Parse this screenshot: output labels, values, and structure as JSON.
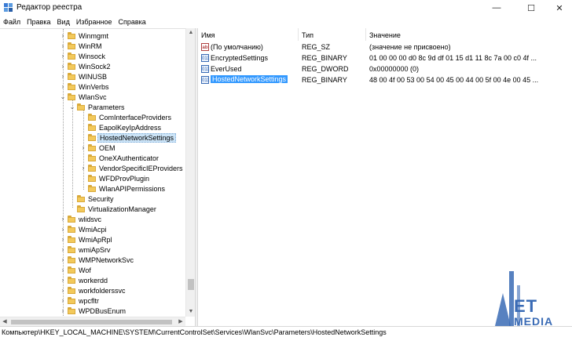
{
  "window": {
    "title": "Редактор реестра",
    "minimize": "—",
    "maximize": "☐",
    "close": "✕"
  },
  "menu": [
    "Файл",
    "Правка",
    "Вид",
    "Избранное",
    "Справка"
  ],
  "tree": [
    {
      "label": "Winmgmt",
      "level": 0,
      "expander": "collapsed"
    },
    {
      "label": "WinRM",
      "level": 0,
      "expander": "collapsed"
    },
    {
      "label": "Winsock",
      "level": 0,
      "expander": "collapsed"
    },
    {
      "label": "WinSock2",
      "level": 0,
      "expander": "collapsed"
    },
    {
      "label": "WINUSB",
      "level": 0,
      "expander": "collapsed"
    },
    {
      "label": "WinVerbs",
      "level": 0,
      "expander": "collapsed"
    },
    {
      "label": "WlanSvc",
      "level": 0,
      "expander": "expanded"
    },
    {
      "label": "Parameters",
      "level": 1,
      "expander": "expanded"
    },
    {
      "label": "ComInterfaceProviders",
      "level": 2,
      "expander": "none"
    },
    {
      "label": "EapolKeyIpAddress",
      "level": 2,
      "expander": "none"
    },
    {
      "label": "HostedNetworkSettings",
      "level": 2,
      "expander": "none",
      "selected": true
    },
    {
      "label": "OEM",
      "level": 2,
      "expander": "collapsed"
    },
    {
      "label": "OneXAuthenticator",
      "level": 2,
      "expander": "none"
    },
    {
      "label": "VendorSpecificIEProviders",
      "level": 2,
      "expander": "collapsed"
    },
    {
      "label": "WFDProvPlugin",
      "level": 2,
      "expander": "none"
    },
    {
      "label": "WlanAPIPermissions",
      "level": 2,
      "expander": "none"
    },
    {
      "label": "Security",
      "level": 1,
      "expander": "none"
    },
    {
      "label": "VirtualizationManager",
      "level": 1,
      "expander": "none"
    },
    {
      "label": "wlidsvc",
      "level": 0,
      "expander": "collapsed"
    },
    {
      "label": "WmiAcpi",
      "level": 0,
      "expander": "collapsed"
    },
    {
      "label": "WmiApRpl",
      "level": 0,
      "expander": "collapsed"
    },
    {
      "label": "wmiApSrv",
      "level": 0,
      "expander": "collapsed"
    },
    {
      "label": "WMPNetworkSvc",
      "level": 0,
      "expander": "collapsed"
    },
    {
      "label": "Wof",
      "level": 0,
      "expander": "collapsed"
    },
    {
      "label": "workerdd",
      "level": 0,
      "expander": "collapsed"
    },
    {
      "label": "workfolderssvc",
      "level": 0,
      "expander": "collapsed"
    },
    {
      "label": "wpcfltr",
      "level": 0,
      "expander": "collapsed"
    },
    {
      "label": "WPDBusEnum",
      "level": 0,
      "expander": "collapsed"
    }
  ],
  "columns": {
    "name": "Имя",
    "type": "Тип",
    "value": "Значение"
  },
  "values": [
    {
      "name": "(По умолчанию)",
      "type": "REG_SZ",
      "data": "(значение не присвоено)",
      "icon": "string-value-icon",
      "glyph": "ab"
    },
    {
      "name": "EncryptedSettings",
      "type": "REG_BINARY",
      "data": "01 00 00 00 d0 8c 9d df 01 15 d1 11 8c 7a 00 c0 4f ...",
      "icon": "binary-value-icon",
      "glyph": "011"
    },
    {
      "name": "EverUsed",
      "type": "REG_DWORD",
      "data": "0x00000000 (0)",
      "icon": "binary-value-icon",
      "glyph": "011"
    },
    {
      "name": "HostedNetworkSettings",
      "type": "REG_BINARY",
      "data": "48 00 4f 00 53 00 54 00 45 00 44 00 5f 00 4e 00 45 ...",
      "icon": "binary-value-icon",
      "glyph": "011",
      "selected": true
    }
  ],
  "status_path": "Компьютер\\HKEY_LOCAL_MACHINE\\SYSTEM\\CurrentControlSet\\Services\\WlanSvc\\Parameters\\HostedNetworkSettings",
  "watermark": {
    "line1": "ET",
    "line2": "MEDIA"
  },
  "colors": {
    "selection": "#3399ff",
    "folder": "#f3c95b",
    "tree_selection": "#cce4f7"
  }
}
